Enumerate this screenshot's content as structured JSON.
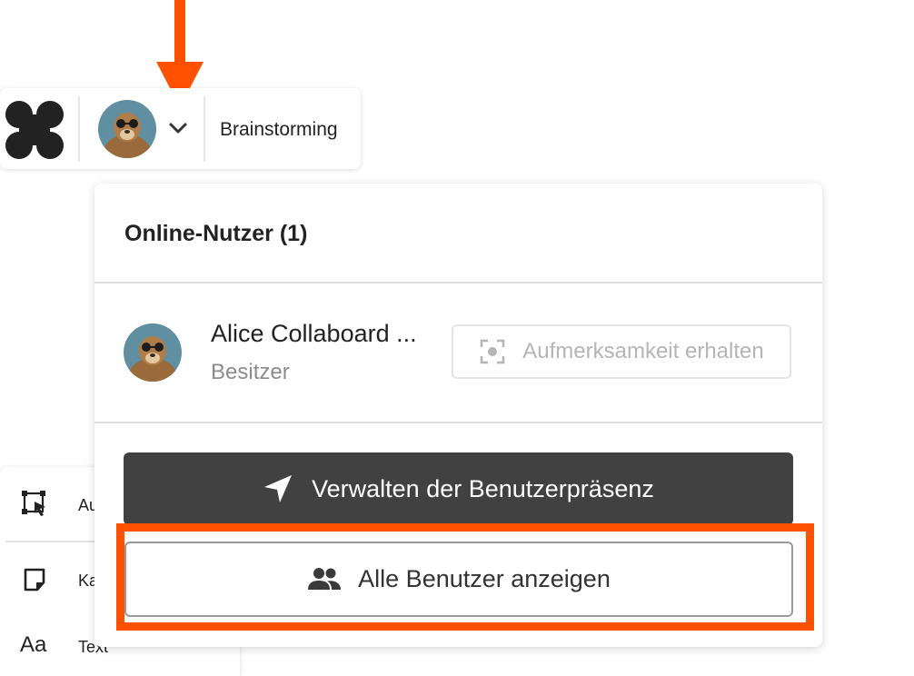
{
  "toolbar": {
    "board_title": "Brainstorming"
  },
  "tools": {
    "items": [
      {
        "label": "Au",
        "icon": "select-area-icon"
      },
      {
        "label": "Ka",
        "icon": "sticky-note-icon"
      },
      {
        "label": "Text",
        "icon": "text-icon",
        "glyph": "Aa"
      }
    ]
  },
  "panel": {
    "title": "Online-Nutzer (1)",
    "user": {
      "name": "Alice Collaboard ...",
      "role": "Besitzer"
    },
    "attention_label": "Aufmerksamkeit erhalten",
    "presence_label": "Verwalten der Benutzerpräsenz",
    "all_users_label": "Alle Benutzer anzeigen"
  },
  "colors": {
    "annotation": "#ff5100",
    "primary_button": "#414141",
    "disabled_text": "#b5b5b5"
  }
}
